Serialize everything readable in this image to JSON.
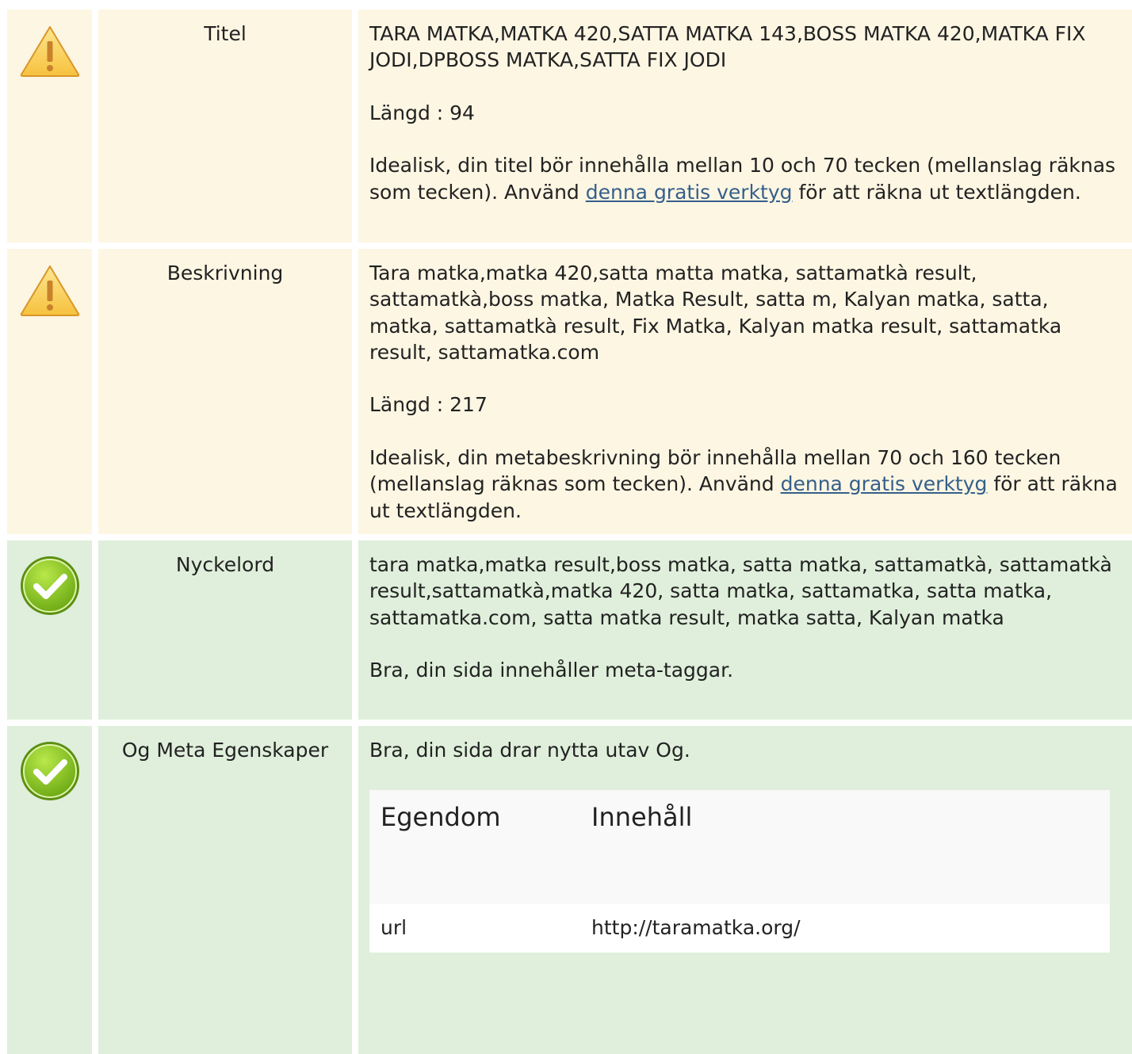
{
  "rows": [
    {
      "status": "warning-icon",
      "label": "Titel",
      "value": "TARA MATKA,MATKA 420,SATTA MATKA 143,BOSS MATKA 420,MATKA FIX JODI,DPBOSS MATKA,SATTA FIX JODI",
      "length_text": "Längd : 94",
      "advice_before": "Idealisk, din titel bör innehålla mellan 10 och 70 tecken (mellanslag räknas som tecken). Använd ",
      "advice_link": "denna gratis verktyg",
      "advice_after": " för att räkna ut textlängden."
    },
    {
      "status": "warning-icon",
      "label": "Beskrivning",
      "value": "Tara matka,matka 420,satta matta matka, sattamatkà result, sattamatkà,boss matka, Matka Result, satta m, Kalyan matka, satta, matka, sattamatkà result, Fix Matka, Kalyan matka result, sattamatka result, sattamatka.com",
      "length_text": "Längd : 217",
      "advice_before": "Idealisk, din metabeskrivning bör innehålla mellan 70 och 160 tecken (mellanslag räknas som tecken). Använd ",
      "advice_link": "denna gratis verktyg",
      "advice_after": " för att räkna ut textlängden."
    },
    {
      "status": "check-icon",
      "label": "Nyckelord",
      "value": "tara matka,matka result,boss matka, satta matka, sattamatkà, sattamatkà result,sattamatkà,matka 420, satta matka, sattamatka, satta matka, sattamatka.com, satta matka result, matka satta, Kalyan matka",
      "message": "Bra, din sida innehåller meta-taggar."
    },
    {
      "status": "check-icon",
      "label": "Og Meta Egenskaper",
      "message": "Bra, din sida drar nytta utav Og.",
      "table": {
        "headers": [
          "Egendom",
          "Innehåll"
        ],
        "rows": [
          {
            "property": "url",
            "content": "http://taramatka.org/"
          }
        ]
      }
    }
  ],
  "colors": {
    "warning_bg": "#fcf6e3",
    "success_bg": "#dfefdb",
    "link": "#355f8a"
  }
}
